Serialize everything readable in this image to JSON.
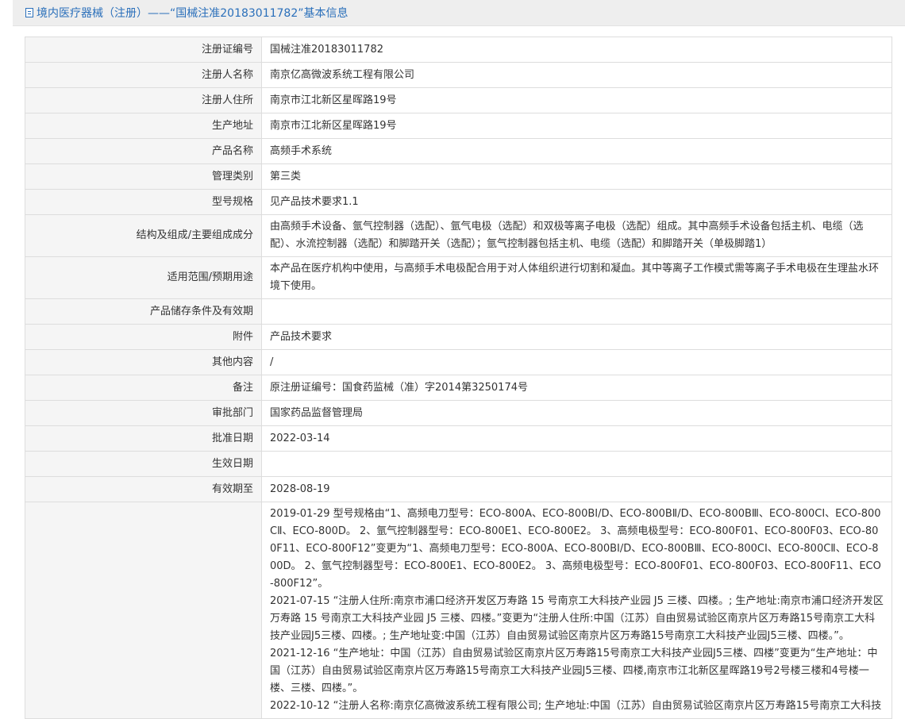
{
  "page": {
    "title": "境内医疗器械（注册）——“国械注准20183011782”基本信息"
  },
  "fields": [
    {
      "label": "注册证编号",
      "value": "国械注准20183011782"
    },
    {
      "label": "注册人名称",
      "value": "南京亿高微波系统工程有限公司"
    },
    {
      "label": "注册人住所",
      "value": "南京市江北新区星晖路19号"
    },
    {
      "label": "生产地址",
      "value": "南京市江北新区星晖路19号"
    },
    {
      "label": "产品名称",
      "value": "高频手术系统"
    },
    {
      "label": "管理类别",
      "value": "第三类"
    },
    {
      "label": "型号规格",
      "value": "见产品技术要求1.1"
    },
    {
      "label": "结构及组成/主要组成成分",
      "value": "由高频手术设备、氩气控制器（选配）、氩气电极（选配）和双极等离子电极（选配）组成。其中高频手术设备包括主机、电缆（选配）、水流控制器（选配）和脚踏开关（选配）；氩气控制器包括主机、电缆（选配）和脚踏开关（单极脚踏1）"
    },
    {
      "label": "适用范围/预期用途",
      "value": "本产品在医疗机构中使用，与高频手术电极配合用于对人体组织进行切割和凝血。其中等离子工作模式需等离子手术电极在生理盐水环境下使用。"
    },
    {
      "label": "产品储存条件及有效期",
      "value": ""
    },
    {
      "label": "附件",
      "value": "产品技术要求"
    },
    {
      "label": "其他内容",
      "value": "/"
    },
    {
      "label": "备注",
      "value": "原注册证编号：国食药监械（准）字2014第3250174号"
    },
    {
      "label": "审批部门",
      "value": "国家药品监督管理局"
    },
    {
      "label": "批准日期",
      "value": "2022-03-14"
    },
    {
      "label": "生效日期",
      "value": ""
    },
    {
      "label": "有效期至",
      "value": "2028-08-19"
    }
  ],
  "change_log": {
    "label": "",
    "entries": [
      "2019-01-29 型号规格由“1、高频电刀型号：ECO-800A、ECO-800BⅠ/D、ECO-800BⅡ/D、ECO-800BⅢ、ECO-800CⅠ、ECO-800CⅡ、ECO-800D。 2、氩气控制器型号：ECO-800E1、ECO-800E2。 3、高频电极型号：ECO-800F01、ECO-800F03、ECO-800F11、ECO-800F12”变更为“1、高频电刀型号：ECO-800A、ECO-800BⅠ/D、ECO-800BⅢ、ECO-800CⅠ、ECO-800CⅡ、ECO-800D。 2、氩气控制器型号：ECO-800E1、ECO-800E2。 3、高频电极型号：ECO-800F01、ECO-800F03、ECO-800F11、ECO-800F12”。",
      "2021-07-15 “注册人住所:南京市浦口经济开发区万寿路 15 号南京工大科技产业园 J5 三楼、四楼。; 生产地址:南京市浦口经济开发区万寿路 15 号南京工大科技产业园 J5 三楼、四楼。”变更为“注册人住所:中国（江苏）自由贸易试验区南京片区万寿路15号南京工大科技产业园J5三楼、四楼。; 生产地址变:中国（江苏）自由贸易试验区南京片区万寿路15号南京工大科技产业园J5三楼、四楼。”。",
      "2021-12-16 “生产地址：中国（江苏）自由贸易试验区南京片区万寿路15号南京工大科技产业园J5三楼、四楼”变更为“生产地址：中国（江苏）自由贸易试验区南京片区万寿路15号南京工大科技产业园J5三楼、四楼,南京市江北新区星晖路19号2号楼三楼和4号楼一楼、三楼、四楼。”。",
      "2022-10-12 “注册人名称:南京亿高微波系统工程有限公司; 生产地址:中国（江苏）自由贸易试验区南京片区万寿路15号南京工大科技"
    ]
  }
}
